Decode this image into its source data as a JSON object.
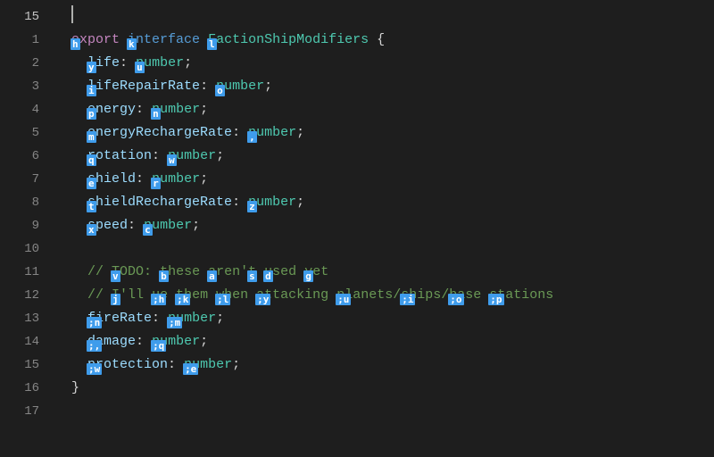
{
  "jump_line_number": "15",
  "gutter": [
    "1",
    "2",
    "3",
    "4",
    "5",
    "6",
    "7",
    "8",
    "9",
    "10",
    "11",
    "12",
    "13",
    "14",
    "15",
    "16",
    "17"
  ],
  "lines": {
    "l1": {
      "t1": "e",
      "h1": "h",
      "t2": "xport ",
      "t3": "i",
      "h2": "k",
      "t4": "nterface ",
      "t5": "F",
      "h3": "l",
      "t6": "actionShipModifiers ",
      "t7": "{"
    },
    "l2": {
      "t1": "l",
      "h1": "y",
      "t2": "ife",
      "t3": ": ",
      "t4": "n",
      "h2": "u",
      "t5": "umber",
      "t6": ";"
    },
    "l3": {
      "t1": "l",
      "h1": "i",
      "t2": "ifeRepairRate",
      "t3": ": ",
      "t4": "n",
      "h2": "o",
      "t5": "umber",
      "t6": ";"
    },
    "l4": {
      "t1": "e",
      "h1": "p",
      "t2": "nergy",
      "t3": ": ",
      "t4": "n",
      "h2": "n",
      "t5": "umber",
      "t6": ";"
    },
    "l5": {
      "t1": "e",
      "h1": "m",
      "t2": "nergyRechargeRate",
      "t3": ": ",
      "t4": "n",
      "h2": ",",
      "t5": "umber",
      "t6": ";"
    },
    "l6": {
      "t1": "r",
      "h1": "q",
      "t2": "otation",
      "t3": ": ",
      "t4": "n",
      "h2": "w",
      "t5": "umber",
      "t6": ";"
    },
    "l7": {
      "t1": "s",
      "h1": "e",
      "t2": "hield",
      "t3": ": ",
      "t4": "n",
      "h2": "r",
      "t5": "umber",
      "t6": ";"
    },
    "l8": {
      "t1": "s",
      "h1": "t",
      "t2": "hieldRechargeRate",
      "t3": ": ",
      "t4": "n",
      "h2": "z",
      "t5": "umber",
      "t6": ";"
    },
    "l9": {
      "t1": "s",
      "h1": "x",
      "t2": "peed",
      "t3": ": ",
      "t4": "n",
      "h2": "c",
      "t5": "umber",
      "t6": ";"
    },
    "l11": {
      "pre": "// ",
      "w1": "T",
      "h1": "v",
      "r1": "ODO: ",
      "w2": "t",
      "h2": "b",
      "r2": "hese ",
      "w3": "a",
      "h3": "a",
      "r3": "ren'",
      "w4": "t",
      "h4": "s",
      "r4": " ",
      "w5": "u",
      "h5": "d",
      "r5": "sed ",
      "w6": "y",
      "h6": "g",
      "r6": "et"
    },
    "l12": {
      "pre": "// ",
      "w1": "I",
      "h1": "j",
      "r1": "'ll ",
      "w2": "u",
      "h2": ";h",
      "r2": "e ",
      "w3": "t",
      "h3": ";k",
      "r3": "hem ",
      "w4": "w",
      "h4": ";l",
      "r4": "hen ",
      "w5": "a",
      "h5": ";y",
      "r5": "ttacking ",
      "w6": "p",
      "h6": ";u",
      "r6": "lanets/",
      "w7": "s",
      "h7": ";i",
      "r7": "hips/",
      "w8": "b",
      "h8": ";o",
      "r8": "ase ",
      "w9": "s",
      "h9": ";p",
      "r9": "tations"
    },
    "l13": {
      "t1": "f",
      "h1": ";n",
      "t2": "ireRate",
      "t3": ": ",
      "t4": "nu",
      "h2": ";m",
      "t5": "mber",
      "t6": ";"
    },
    "l14": {
      "t1": "d",
      "h1": ";,",
      "t2": "amage",
      "t3": ": ",
      "t4": "nu",
      "h2": ";q",
      "t5": "mber",
      "t6": ";"
    },
    "l15": {
      "t1": "p",
      "h1": ";w",
      "t2": "rotection",
      "t3": ": ",
      "t4": "nu",
      "h2": ";e",
      "t5": "mber",
      "t6": ";"
    },
    "l16": {
      "t1": "}"
    }
  }
}
